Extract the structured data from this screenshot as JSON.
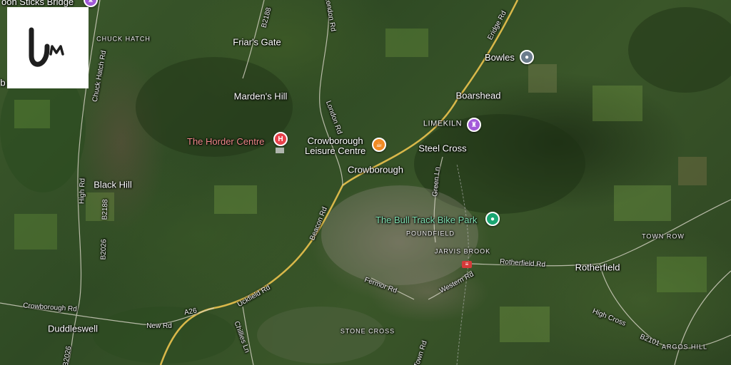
{
  "map": {
    "places": [
      {
        "id": "friars-gate",
        "text": "Friar's Gate"
      },
      {
        "id": "mardens-hill",
        "text": "Marden's Hill"
      },
      {
        "id": "black-hill",
        "text": "Black Hill"
      },
      {
        "id": "boarshead",
        "text": "Boarshead"
      },
      {
        "id": "steel-cross",
        "text": "Steel Cross"
      },
      {
        "id": "crowborough",
        "text": "Crowborough"
      },
      {
        "id": "rotherfield",
        "text": "Rotherfield"
      },
      {
        "id": "duddleswell",
        "text": "Duddleswell"
      }
    ],
    "areas": [
      {
        "id": "chuck-hatch",
        "text": "CHUCK HATCH"
      },
      {
        "id": "limekiln",
        "text": "LIMEKILN"
      },
      {
        "id": "poundfield",
        "text": "POUNDFIELD"
      },
      {
        "id": "jarvis-brook",
        "text": "JARVIS BROOK"
      },
      {
        "id": "town-row",
        "text": "TOWN ROW"
      },
      {
        "id": "stone-cross",
        "text": "STONE CROSS"
      },
      {
        "id": "argos-hill",
        "text": "ARGOS HILL"
      }
    ],
    "roads": [
      {
        "id": "b2188-top",
        "text": "B2188"
      },
      {
        "id": "london-rd-top",
        "text": "London Rd"
      },
      {
        "id": "eridge-rd",
        "text": "Eridge Rd"
      },
      {
        "id": "chuck-hatch-rd",
        "text": "Chuck Hatch Rd"
      },
      {
        "id": "london-rd-mid",
        "text": "London Rd"
      },
      {
        "id": "green-ln",
        "text": "Green Ln"
      },
      {
        "id": "high-rd",
        "text": "High Rd"
      },
      {
        "id": "b2188-left",
        "text": "B2188"
      },
      {
        "id": "b2026-left",
        "text": "B2026"
      },
      {
        "id": "beacon-rd",
        "text": "Beacon Rd"
      },
      {
        "id": "rotherfield-rd",
        "text": "Rotherfield Rd"
      },
      {
        "id": "fermor-rd",
        "text": "Fermor Rd"
      },
      {
        "id": "western-rd",
        "text": "Western Rd"
      },
      {
        "id": "uckfield-rd",
        "text": "Uckfield Rd"
      },
      {
        "id": "crowborough-rd",
        "text": "Crowborough Rd"
      },
      {
        "id": "a26",
        "text": "A26"
      },
      {
        "id": "new-rd",
        "text": "New Rd"
      },
      {
        "id": "chillies-ln",
        "text": "Chillies Ln"
      },
      {
        "id": "high-cross",
        "text": "High Cross"
      },
      {
        "id": "b2101",
        "text": "B2101"
      },
      {
        "id": "b2026-bottom",
        "text": "B2026"
      },
      {
        "id": "town-ln",
        "text": "Town Rd"
      },
      {
        "id": "b2026-mid",
        "text": "B2026"
      }
    ],
    "pois": [
      {
        "id": "horder-centre",
        "text": "The Horder Centre",
        "icon": "hospital-icon",
        "color": "#e8414b"
      },
      {
        "id": "leisure-centre",
        "text": "Crowborough\nLeisure Centre",
        "icon": "coffee-cup-icon",
        "color": "#f08a24"
      },
      {
        "id": "bowles",
        "text": "Bowles",
        "icon": "location-pin-icon",
        "color": "#6b7c8c"
      },
      {
        "id": "limekiln-icon",
        "text": "",
        "icon": "castle-icon",
        "color": "#a259d9"
      },
      {
        "id": "bull-track",
        "text": "The Bull Track Bike Park",
        "icon": "park-pin-icon",
        "color": "#1aa672"
      },
      {
        "id": "sticks-bridge",
        "text": "oon Sticks Bridge",
        "icon": "castle-icon",
        "color": "#a259d9"
      }
    ],
    "station_icon": "train-station-icon",
    "partial_left_label": "b"
  },
  "logo": {
    "name": "um-logo"
  }
}
